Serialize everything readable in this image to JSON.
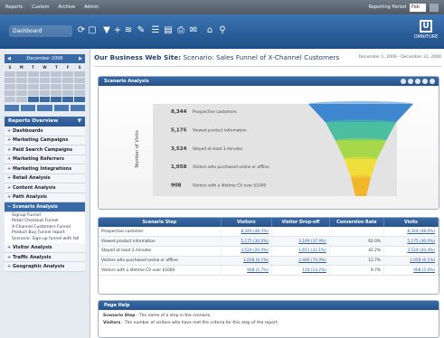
{
  "topbar": {
    "menu": [
      "Reports",
      "Custom",
      "Archive",
      "Admin"
    ],
    "right_label": "Reporting Period",
    "right_select": "Feb"
  },
  "toolbar": {
    "dashboard_label": "Dashboard",
    "icons": [
      "refresh-icon",
      "window-icon",
      "filter-icon",
      "plus-icon",
      "graph-icon",
      "pin-icon",
      "stack-icon",
      "document-icon",
      "print-icon",
      "email-icon",
      "home-icon",
      "link-icon"
    ],
    "logo_letter": "U",
    "logo_text": "OMNITURE"
  },
  "sidebar": {
    "calendar_title": "December 2006",
    "weekdays": [
      "S",
      "M",
      "T",
      "W",
      "T",
      "F",
      "S"
    ],
    "reports_title": "Reports Overview",
    "nav_items": [
      {
        "label": "Dashboards"
      },
      {
        "label": "Marketing Campaigns"
      },
      {
        "label": "Paid Search Campaigns"
      },
      {
        "label": "Marketing Referrers"
      },
      {
        "label": "Marketing Integrations"
      },
      {
        "label": "Retail Analysis"
      },
      {
        "label": "Content Analysis"
      },
      {
        "label": "Path Analysis"
      },
      {
        "label": "Scenario Analysis",
        "active": true
      }
    ],
    "sub_items": [
      "Signup Funnel",
      "Retail Checkout Funnel",
      "X-Channel Customers Funnel",
      "Product Buy Funnel report",
      "Scenario: Sign-up funnel with fall"
    ],
    "bottom_items": [
      "Visitor Analysis",
      "Traffic Analysis",
      "Geographic Analysis"
    ]
  },
  "main": {
    "title_prefix": "Our Business Web Site:",
    "title_rest": "Scenario: Sales Funnel of X-Channel Customers",
    "date_range": "December 1, 2006 - December 31, 2006"
  },
  "funnel_panel": {
    "title": "Scenario Analysis",
    "y_label": "Number of Visits",
    "steps": [
      {
        "value": "8,344",
        "label": "Prospective customers",
        "color": "#3e86cf"
      },
      {
        "value": "5,175",
        "label": "Viewed product information",
        "color": "#4bbfa0"
      },
      {
        "value": "3,524",
        "label": "Stayed at least 3 minutes",
        "color": "#a6d84a"
      },
      {
        "value": "1,058",
        "label": "Visitors who purchased online or offline",
        "color": "#f0de3a"
      },
      {
        "value": "908",
        "label": "Visitors with a lifetime CV over $1000",
        "color": "#f2b62b"
      }
    ]
  },
  "table": {
    "headers": [
      "Scenario Step",
      "Visitors",
      "Visitor Drop-off",
      "Conversion Rate",
      "Visits"
    ],
    "rows": [
      {
        "step": "Prospective customer",
        "visitors": "8,344 (48.3%)",
        "dropoff": "",
        "conv": "",
        "visits": "8,344 (48.0%)"
      },
      {
        "step": "Viewed product information",
        "visitors": "5,175 (30.0%)",
        "dropoff": "3,169 (37.9%)",
        "conv": "62.0%",
        "visits": "5,175 (30.0%)"
      },
      {
        "step": "Stayed at least 3 minutes",
        "visitors": "3,524 (20.4%)",
        "dropoff": "1,651 (32.1%)",
        "conv": "42.2%",
        "visits": "3,524 (20.4%)"
      },
      {
        "step": "Visitors who purchased online or offline",
        "visitors": "1,058 (6.1%)",
        "dropoff": "2,466 (70.0%)",
        "conv": "12.7%",
        "visits": "1,058 (6.1%)"
      },
      {
        "step": "Visitors with a lifetime CV over $1000",
        "visitors": "908 (5.7%)",
        "dropoff": "150 (14.2%)",
        "conv": "9.7%",
        "visits": "908 (5.0%)"
      }
    ]
  },
  "help_panel": {
    "title": "Page Help",
    "line1_label": "Scenario Step",
    "line1_text": " - The name of a step in the scenario.",
    "line2_label": "Visitors",
    "line2_text": " - The number of visitors who have met the criteria for this step of the report."
  }
}
